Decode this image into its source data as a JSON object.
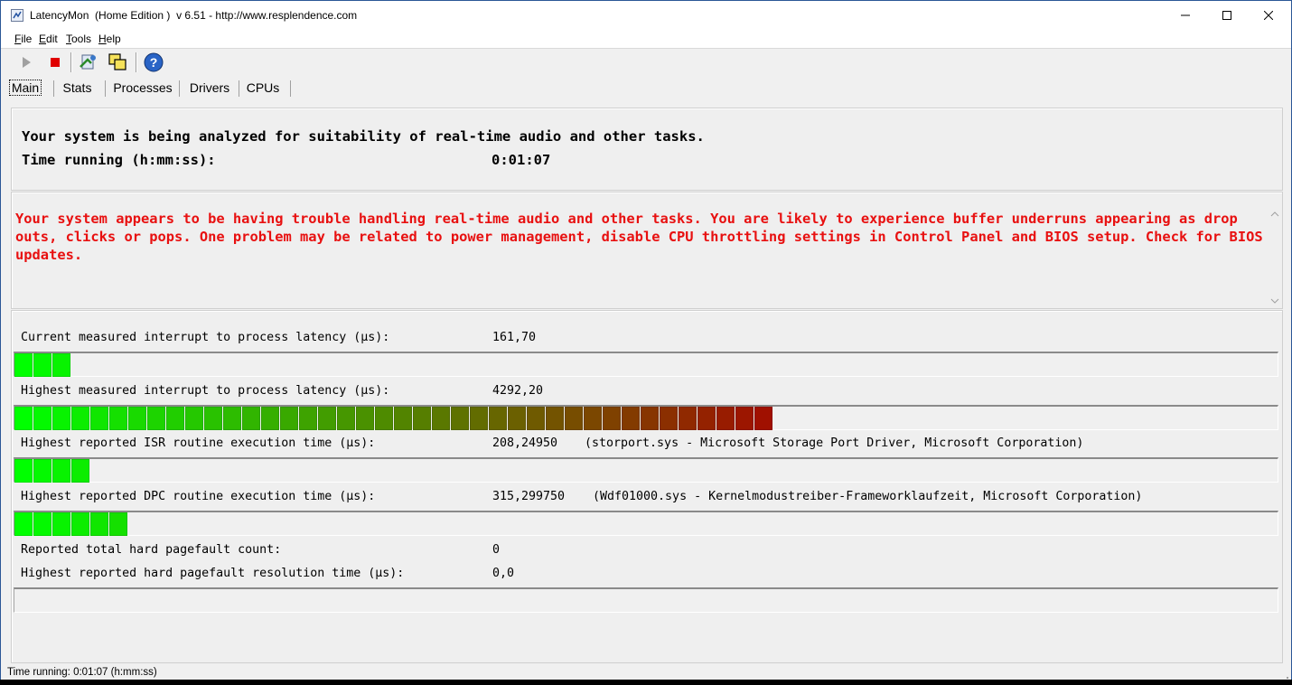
{
  "window": {
    "title": "LatencyMon  (Home Edition )  v 6.51 - http://www.resplendence.com"
  },
  "menu": [
    {
      "pre": "",
      "u": "F",
      "post": "ile"
    },
    {
      "pre": "",
      "u": "E",
      "post": "dit"
    },
    {
      "pre": "",
      "u": "T",
      "post": "ools"
    },
    {
      "pre": "",
      "u": "H",
      "post": "elp"
    }
  ],
  "toolbar": {
    "icons": [
      "play-icon",
      "stop-icon",
      "report-icon",
      "windows-icon",
      "help-icon"
    ]
  },
  "tabs": [
    {
      "label": "Main"
    },
    {
      "label": "Stats"
    },
    {
      "label": "Processes"
    },
    {
      "label": "Drivers"
    },
    {
      "label": "CPUs"
    }
  ],
  "status_panel": {
    "analysis_text": "Your system is being analyzed for suitability of real-time audio and other tasks.",
    "time_label": "Time running (h:mm:ss):",
    "time_value": "0:01:07"
  },
  "verdict": {
    "text": "Your system appears to be having trouble handling real-time audio and other tasks. You are likely to experience buffer underruns appearing as drop outs, clicks or pops. One problem may be related to power management, disable CPU throttling settings in Control Panel and BIOS setup. Check for BIOS updates.",
    "color": "#e81010"
  },
  "metrics": {
    "current_latency": {
      "label": "Current measured interrupt to process latency (µs):",
      "value": "161,70",
      "segments": 3
    },
    "highest_latency": {
      "label": "Highest measured interrupt to process latency (µs):",
      "value": "4292,20",
      "segments": 40
    },
    "isr": {
      "label": "Highest reported ISR routine execution time (µs):",
      "value": "208,24950",
      "driver": "(storport.sys - Microsoft Storage Port Driver, Microsoft Corporation)",
      "segments": 4
    },
    "dpc": {
      "label": "Highest reported DPC routine execution time (µs):",
      "value": "315,299750",
      "driver": "(Wdf01000.sys - Kernelmodustreiber-Frameworklaufzeit, Microsoft Corporation)",
      "segments": 6
    },
    "pagefault_count": {
      "label": "Reported total hard pagefault count:",
      "value": "0"
    },
    "pagefault_time": {
      "label": "Highest reported hard pagefault resolution time (µs):",
      "value": "0,0",
      "segments": 0
    }
  },
  "colors": {
    "bar_start": "#00ff00",
    "bar_end": "#a01000"
  },
  "statusbar": {
    "text": "Time running: 0:01:07  (h:mm:ss)"
  }
}
